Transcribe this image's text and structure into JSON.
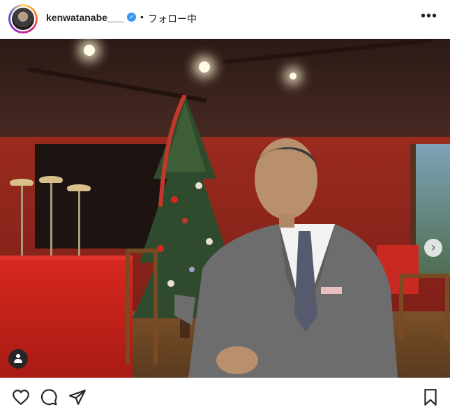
{
  "header": {
    "username": "kenwatanabe___",
    "verified_mark": "✓",
    "separator": "•",
    "follow_status": "フォロー中",
    "more_icon": "more-horizontal-icon",
    "more_glyph": "•••"
  },
  "post": {
    "next_glyph": "›",
    "icons": [
      "like-heart-icon",
      "comment-icon",
      "share-icon",
      "save-bookmark-icon",
      "tagged-user-icon",
      "next-arrow-icon"
    ]
  },
  "colors": {
    "verified": "#3897f0",
    "text": "#262626"
  }
}
